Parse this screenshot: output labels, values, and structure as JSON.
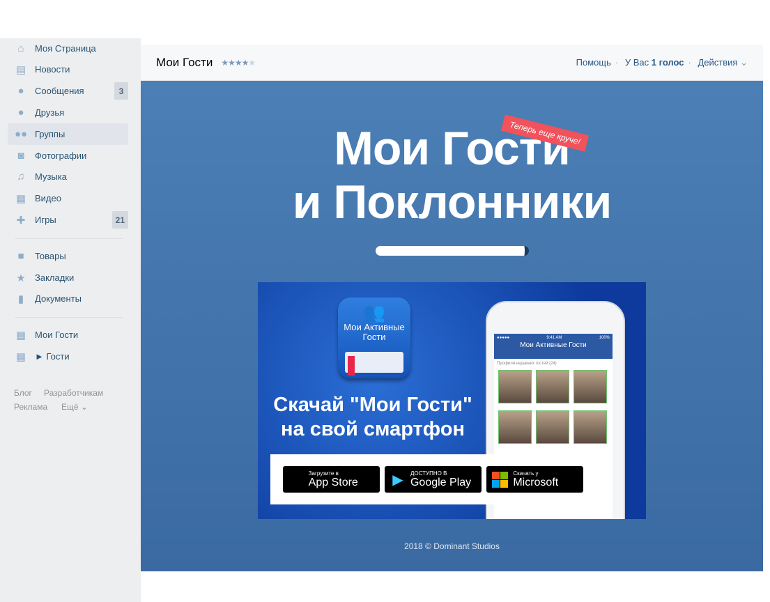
{
  "sidebar": {
    "items": [
      {
        "label": "Моя Страница",
        "icon": "home-icon"
      },
      {
        "label": "Новости",
        "icon": "news-icon"
      },
      {
        "label": "Сообщения",
        "icon": "messages-icon",
        "badge": "3"
      },
      {
        "label": "Друзья",
        "icon": "friends-icon"
      },
      {
        "label": "Группы",
        "icon": "groups-icon",
        "active": true
      },
      {
        "label": "Фотографии",
        "icon": "camera-icon"
      },
      {
        "label": "Музыка",
        "icon": "music-icon"
      },
      {
        "label": "Видео",
        "icon": "video-icon"
      },
      {
        "label": "Игры",
        "icon": "gamepad-icon",
        "badge": "21"
      },
      {
        "label": "Товары",
        "icon": "bag-icon"
      },
      {
        "label": "Закладки",
        "icon": "star-icon"
      },
      {
        "label": "Документы",
        "icon": "document-icon"
      },
      {
        "label": "Мои Гости",
        "icon": "app-grid-icon"
      },
      {
        "label": "► Гости",
        "icon": "app-grid-icon"
      }
    ],
    "footer": {
      "blog": "Блог",
      "developers": "Разработчикам",
      "ads": "Реклама",
      "more": "Ещё"
    }
  },
  "header": {
    "title": "Мои Гости",
    "rating": 4,
    "rating_max": 5,
    "help": "Помощь",
    "votes_prefix": "У Вас",
    "votes_bold": "1 голос",
    "actions": "Действия"
  },
  "banner": {
    "title_line1": "Мои Гости",
    "title_line2": "и Поклонники",
    "tag": "Теперь еще круче!",
    "progress": 0.97,
    "ad": {
      "app_name": "Мои Активные Гости",
      "headline1": "Скачай \"Мои Гости\"",
      "headline2": "на свой смартфон",
      "screen_title": "Мои Активные Гости",
      "screen_time": "9:41 AM",
      "screen_battery": "100%",
      "screen_subtitle": "Профили недавних гостей (24)",
      "stores": [
        {
          "small": "Загрузите в",
          "big": "App Store",
          "icon": "apple-icon"
        },
        {
          "small": "ДОСТУПНО В",
          "big": "Google Play",
          "icon": "google-play-icon"
        },
        {
          "small": "Скачать у",
          "big": "Microsoft",
          "icon": "microsoft-icon"
        }
      ]
    },
    "copyright": "2018 © Dominant Studios"
  },
  "colors": {
    "sidebar_bg": "#edeef0",
    "link": "#2a5885",
    "banner": "#4a7db3",
    "tag": "#f1525b"
  }
}
